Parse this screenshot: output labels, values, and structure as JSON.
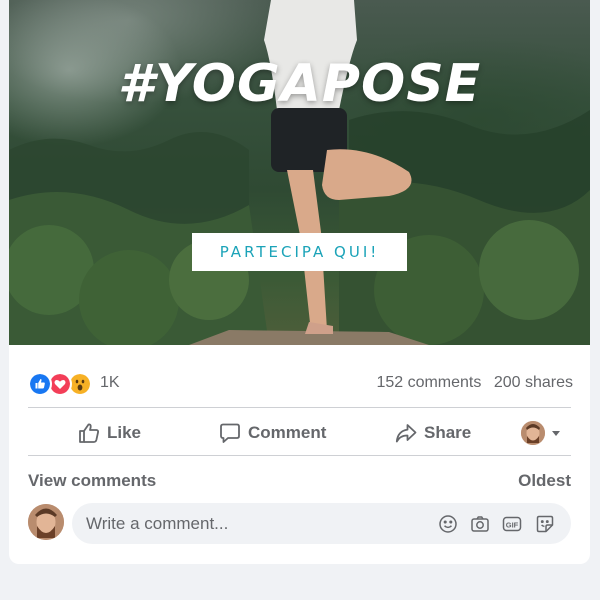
{
  "post": {
    "image": {
      "hashtag": "#YOGAPOSE",
      "cta_label": "PARTECIPA QUI!"
    },
    "reactions": {
      "icons": [
        "like-reaction",
        "love-reaction",
        "wow-reaction"
      ],
      "count": "1K"
    },
    "stats": {
      "comments": "152 comments",
      "shares": "200 shares"
    },
    "actions": {
      "like": "Like",
      "comment": "Comment",
      "share": "Share"
    },
    "comments_section": {
      "view_label": "View comments",
      "sort_label": "Oldest",
      "input_placeholder": "Write a comment...",
      "input_tools": [
        "emoji-icon",
        "camera-icon",
        "gif-icon",
        "sticker-icon"
      ]
    }
  },
  "colors": {
    "like_blue": "#1877f2",
    "love_red": "#f33e58",
    "wow_yellow": "#f7b125",
    "cta_teal": "#1ba3b8",
    "muted_text": "#65676b",
    "divider": "#ced0d4"
  }
}
